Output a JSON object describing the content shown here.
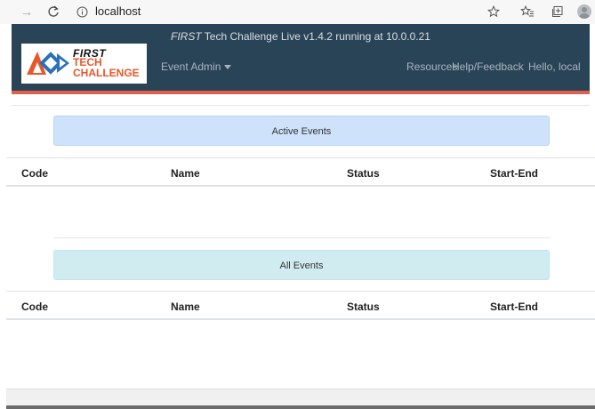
{
  "browser": {
    "url": "localhost"
  },
  "header": {
    "running_brand": "FIRST",
    "running_text": " Tech Challenge Live v1.4.2 running at 10.0.0.21",
    "logo": {
      "line1": "FIRST",
      "line2": "TECH",
      "line3": "CHALLENGE"
    },
    "nav_event_admin": "Event Admin",
    "nav_resources": "Resources",
    "nav_help": "Help/Feedback",
    "nav_hello": "Hello, local",
    "colors": {
      "bar": "#2a4457",
      "accent": "#e06050",
      "logo_orange": "#e8572a"
    }
  },
  "active_events": {
    "title": "Active Events",
    "columns": [
      "Code",
      "Name",
      "Status",
      "Start-End"
    ],
    "rows": []
  },
  "all_events": {
    "title": "All Events",
    "columns": [
      "Code",
      "Name",
      "Status",
      "Start-End"
    ],
    "rows": []
  }
}
